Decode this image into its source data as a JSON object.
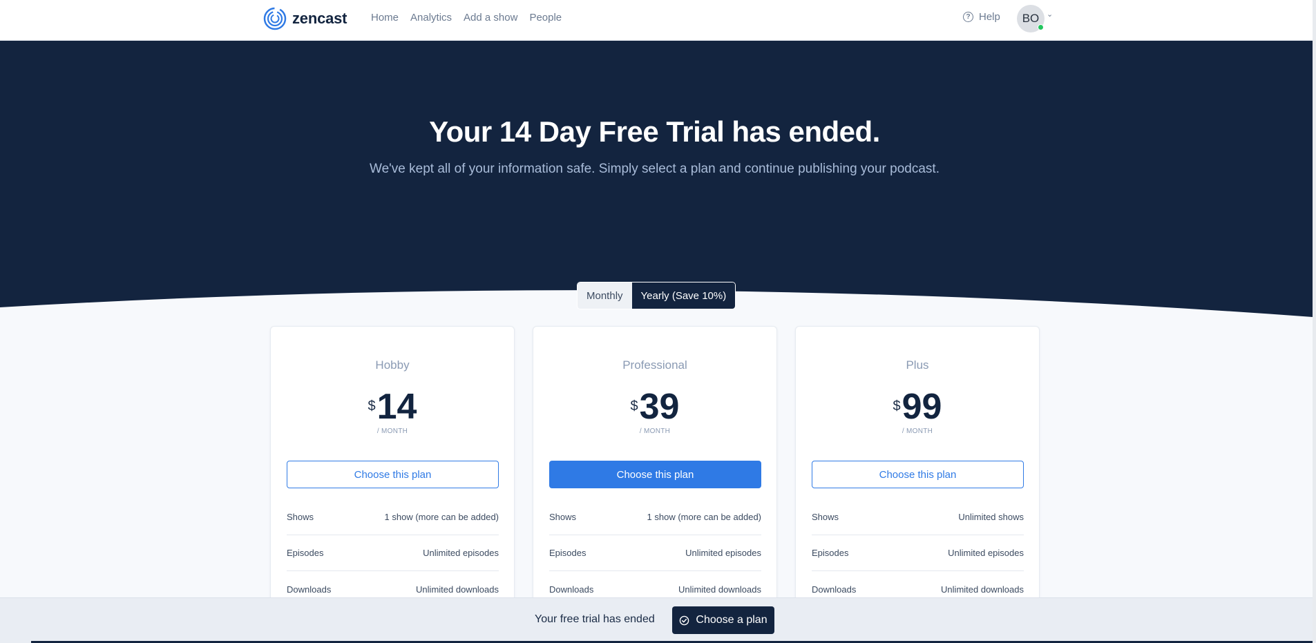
{
  "brand": {
    "name": "zencast",
    "accent": "#2f7ae5",
    "navy": "#13243f"
  },
  "nav": {
    "links": [
      "Home",
      "Analytics",
      "Add a show",
      "People"
    ],
    "help_label": "Help",
    "help_icon": "question-circle-icon",
    "avatar_initials": "BO"
  },
  "hero": {
    "title": "Your 14 Day Free Trial has ended.",
    "subtitle": "We've kept all of your information safe. Simply select a plan and continue publishing your podcast."
  },
  "billing_toggle": {
    "monthly": "Monthly",
    "yearly": "Yearly (Save 10%)",
    "selected": "Monthly"
  },
  "plans": [
    {
      "name": "Hobby",
      "currency": "$",
      "price": "14",
      "period": "/ MONTH",
      "button": "Choose this plan",
      "highlighted": false,
      "features": [
        {
          "label": "Shows",
          "value": "1 show (more can be added)"
        },
        {
          "label": "Episodes",
          "value": "Unlimited episodes"
        },
        {
          "label": "Downloads",
          "value": "Unlimited downloads"
        }
      ]
    },
    {
      "name": "Professional",
      "currency": "$",
      "price": "39",
      "period": "/ MONTH",
      "button": "Choose this plan",
      "highlighted": true,
      "features": [
        {
          "label": "Shows",
          "value": "1 show (more can be added)"
        },
        {
          "label": "Episodes",
          "value": "Unlimited episodes"
        },
        {
          "label": "Downloads",
          "value": "Unlimited downloads"
        }
      ]
    },
    {
      "name": "Plus",
      "currency": "$",
      "price": "99",
      "period": "/ MONTH",
      "button": "Choose this plan",
      "highlighted": false,
      "features": [
        {
          "label": "Shows",
          "value": "Unlimited shows"
        },
        {
          "label": "Episodes",
          "value": "Unlimited episodes"
        },
        {
          "label": "Downloads",
          "value": "Unlimited downloads"
        }
      ]
    }
  ],
  "bottom_bar": {
    "text": "Your free trial has ended",
    "button": "Choose a plan",
    "button_icon": "check-circle-icon"
  }
}
